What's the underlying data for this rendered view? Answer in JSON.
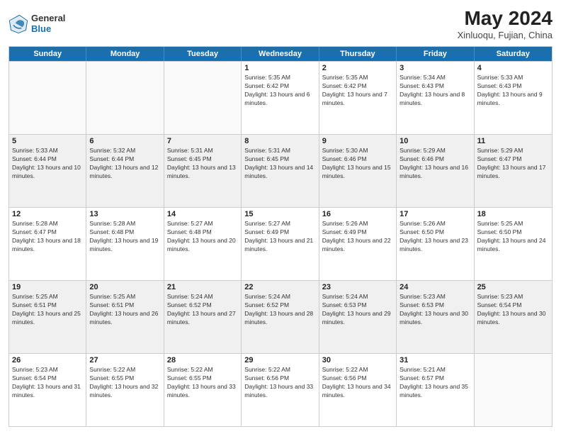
{
  "logo": {
    "general": "General",
    "blue": "Blue"
  },
  "title": {
    "month": "May 2024",
    "location": "Xinluoqu, Fujian, China"
  },
  "weekdays": [
    "Sunday",
    "Monday",
    "Tuesday",
    "Wednesday",
    "Thursday",
    "Friday",
    "Saturday"
  ],
  "weeks": [
    [
      {
        "day": "",
        "sunrise": "",
        "sunset": "",
        "daylight": "",
        "empty": true
      },
      {
        "day": "",
        "sunrise": "",
        "sunset": "",
        "daylight": "",
        "empty": true
      },
      {
        "day": "",
        "sunrise": "",
        "sunset": "",
        "daylight": "",
        "empty": true
      },
      {
        "day": "1",
        "sunrise": "Sunrise: 5:35 AM",
        "sunset": "Sunset: 6:42 PM",
        "daylight": "Daylight: 13 hours and 6 minutes.",
        "empty": false
      },
      {
        "day": "2",
        "sunrise": "Sunrise: 5:35 AM",
        "sunset": "Sunset: 6:42 PM",
        "daylight": "Daylight: 13 hours and 7 minutes.",
        "empty": false
      },
      {
        "day": "3",
        "sunrise": "Sunrise: 5:34 AM",
        "sunset": "Sunset: 6:43 PM",
        "daylight": "Daylight: 13 hours and 8 minutes.",
        "empty": false
      },
      {
        "day": "4",
        "sunrise": "Sunrise: 5:33 AM",
        "sunset": "Sunset: 6:43 PM",
        "daylight": "Daylight: 13 hours and 9 minutes.",
        "empty": false
      }
    ],
    [
      {
        "day": "5",
        "sunrise": "Sunrise: 5:33 AM",
        "sunset": "Sunset: 6:44 PM",
        "daylight": "Daylight: 13 hours and 10 minutes.",
        "empty": false
      },
      {
        "day": "6",
        "sunrise": "Sunrise: 5:32 AM",
        "sunset": "Sunset: 6:44 PM",
        "daylight": "Daylight: 13 hours and 12 minutes.",
        "empty": false
      },
      {
        "day": "7",
        "sunrise": "Sunrise: 5:31 AM",
        "sunset": "Sunset: 6:45 PM",
        "daylight": "Daylight: 13 hours and 13 minutes.",
        "empty": false
      },
      {
        "day": "8",
        "sunrise": "Sunrise: 5:31 AM",
        "sunset": "Sunset: 6:45 PM",
        "daylight": "Daylight: 13 hours and 14 minutes.",
        "empty": false
      },
      {
        "day": "9",
        "sunrise": "Sunrise: 5:30 AM",
        "sunset": "Sunset: 6:46 PM",
        "daylight": "Daylight: 13 hours and 15 minutes.",
        "empty": false
      },
      {
        "day": "10",
        "sunrise": "Sunrise: 5:29 AM",
        "sunset": "Sunset: 6:46 PM",
        "daylight": "Daylight: 13 hours and 16 minutes.",
        "empty": false
      },
      {
        "day": "11",
        "sunrise": "Sunrise: 5:29 AM",
        "sunset": "Sunset: 6:47 PM",
        "daylight": "Daylight: 13 hours and 17 minutes.",
        "empty": false
      }
    ],
    [
      {
        "day": "12",
        "sunrise": "Sunrise: 5:28 AM",
        "sunset": "Sunset: 6:47 PM",
        "daylight": "Daylight: 13 hours and 18 minutes.",
        "empty": false
      },
      {
        "day": "13",
        "sunrise": "Sunrise: 5:28 AM",
        "sunset": "Sunset: 6:48 PM",
        "daylight": "Daylight: 13 hours and 19 minutes.",
        "empty": false
      },
      {
        "day": "14",
        "sunrise": "Sunrise: 5:27 AM",
        "sunset": "Sunset: 6:48 PM",
        "daylight": "Daylight: 13 hours and 20 minutes.",
        "empty": false
      },
      {
        "day": "15",
        "sunrise": "Sunrise: 5:27 AM",
        "sunset": "Sunset: 6:49 PM",
        "daylight": "Daylight: 13 hours and 21 minutes.",
        "empty": false
      },
      {
        "day": "16",
        "sunrise": "Sunrise: 5:26 AM",
        "sunset": "Sunset: 6:49 PM",
        "daylight": "Daylight: 13 hours and 22 minutes.",
        "empty": false
      },
      {
        "day": "17",
        "sunrise": "Sunrise: 5:26 AM",
        "sunset": "Sunset: 6:50 PM",
        "daylight": "Daylight: 13 hours and 23 minutes.",
        "empty": false
      },
      {
        "day": "18",
        "sunrise": "Sunrise: 5:25 AM",
        "sunset": "Sunset: 6:50 PM",
        "daylight": "Daylight: 13 hours and 24 minutes.",
        "empty": false
      }
    ],
    [
      {
        "day": "19",
        "sunrise": "Sunrise: 5:25 AM",
        "sunset": "Sunset: 6:51 PM",
        "daylight": "Daylight: 13 hours and 25 minutes.",
        "empty": false
      },
      {
        "day": "20",
        "sunrise": "Sunrise: 5:25 AM",
        "sunset": "Sunset: 6:51 PM",
        "daylight": "Daylight: 13 hours and 26 minutes.",
        "empty": false
      },
      {
        "day": "21",
        "sunrise": "Sunrise: 5:24 AM",
        "sunset": "Sunset: 6:52 PM",
        "daylight": "Daylight: 13 hours and 27 minutes.",
        "empty": false
      },
      {
        "day": "22",
        "sunrise": "Sunrise: 5:24 AM",
        "sunset": "Sunset: 6:52 PM",
        "daylight": "Daylight: 13 hours and 28 minutes.",
        "empty": false
      },
      {
        "day": "23",
        "sunrise": "Sunrise: 5:24 AM",
        "sunset": "Sunset: 6:53 PM",
        "daylight": "Daylight: 13 hours and 29 minutes.",
        "empty": false
      },
      {
        "day": "24",
        "sunrise": "Sunrise: 5:23 AM",
        "sunset": "Sunset: 6:53 PM",
        "daylight": "Daylight: 13 hours and 30 minutes.",
        "empty": false
      },
      {
        "day": "25",
        "sunrise": "Sunrise: 5:23 AM",
        "sunset": "Sunset: 6:54 PM",
        "daylight": "Daylight: 13 hours and 30 minutes.",
        "empty": false
      }
    ],
    [
      {
        "day": "26",
        "sunrise": "Sunrise: 5:23 AM",
        "sunset": "Sunset: 6:54 PM",
        "daylight": "Daylight: 13 hours and 31 minutes.",
        "empty": false
      },
      {
        "day": "27",
        "sunrise": "Sunrise: 5:22 AM",
        "sunset": "Sunset: 6:55 PM",
        "daylight": "Daylight: 13 hours and 32 minutes.",
        "empty": false
      },
      {
        "day": "28",
        "sunrise": "Sunrise: 5:22 AM",
        "sunset": "Sunset: 6:55 PM",
        "daylight": "Daylight: 13 hours and 33 minutes.",
        "empty": false
      },
      {
        "day": "29",
        "sunrise": "Sunrise: 5:22 AM",
        "sunset": "Sunset: 6:56 PM",
        "daylight": "Daylight: 13 hours and 33 minutes.",
        "empty": false
      },
      {
        "day": "30",
        "sunrise": "Sunrise: 5:22 AM",
        "sunset": "Sunset: 6:56 PM",
        "daylight": "Daylight: 13 hours and 34 minutes.",
        "empty": false
      },
      {
        "day": "31",
        "sunrise": "Sunrise: 5:21 AM",
        "sunset": "Sunset: 6:57 PM",
        "daylight": "Daylight: 13 hours and 35 minutes.",
        "empty": false
      },
      {
        "day": "",
        "sunrise": "",
        "sunset": "",
        "daylight": "",
        "empty": true
      }
    ]
  ]
}
